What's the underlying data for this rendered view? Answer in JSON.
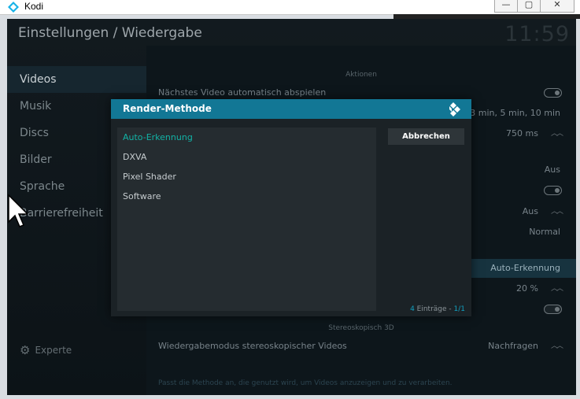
{
  "window": {
    "title": "Kodi",
    "minimize_glyph": "—",
    "maximize_glyph": "▢",
    "close_glyph": "✕"
  },
  "header": {
    "title": "Einstellungen / Wiedergabe",
    "clock": "11:59"
  },
  "sidebar": {
    "items": [
      {
        "label": "Videos",
        "active": true
      },
      {
        "label": "Musik"
      },
      {
        "label": "Discs"
      },
      {
        "label": "Bilder"
      },
      {
        "label": "Sprache"
      },
      {
        "label": "Barrierefreiheit"
      }
    ],
    "expert_label": "Experte",
    "expert_icon": "gear-icon"
  },
  "settings": {
    "section_actions": "Aktionen",
    "row_next_video": "Nächstes Video automatisch abspielen",
    "row_time_values": "s, 3 min, 5 min, 10 min",
    "row_750": "750 ms",
    "row_aus1": "Aus",
    "row_aus2": "Aus",
    "row_normal": "Normal",
    "row_render_value": "Auto-Erkennung",
    "row_20": "20 %",
    "section_stereo": "Stereoskopisch 3D",
    "row_stereo_label": "Wiedergabemodus stereoskopischer Videos",
    "row_stereo_value": "Nachfragen",
    "help_text": "Passt die Methode an, die genutzt wird, um Videos anzuzeigen und zu verarbeiten."
  },
  "dialog": {
    "title": "Render-Methode",
    "options": [
      "Auto-Erkennung",
      "DXVA",
      "Pixel Shader",
      "Software"
    ],
    "selected_index": 0,
    "cancel_label": "Abbrechen",
    "count_num": "4",
    "count_label": " Einträge - ",
    "page": "1/1"
  },
  "colors": {
    "accent": "#127795",
    "selected_text": "#12b2a5"
  }
}
